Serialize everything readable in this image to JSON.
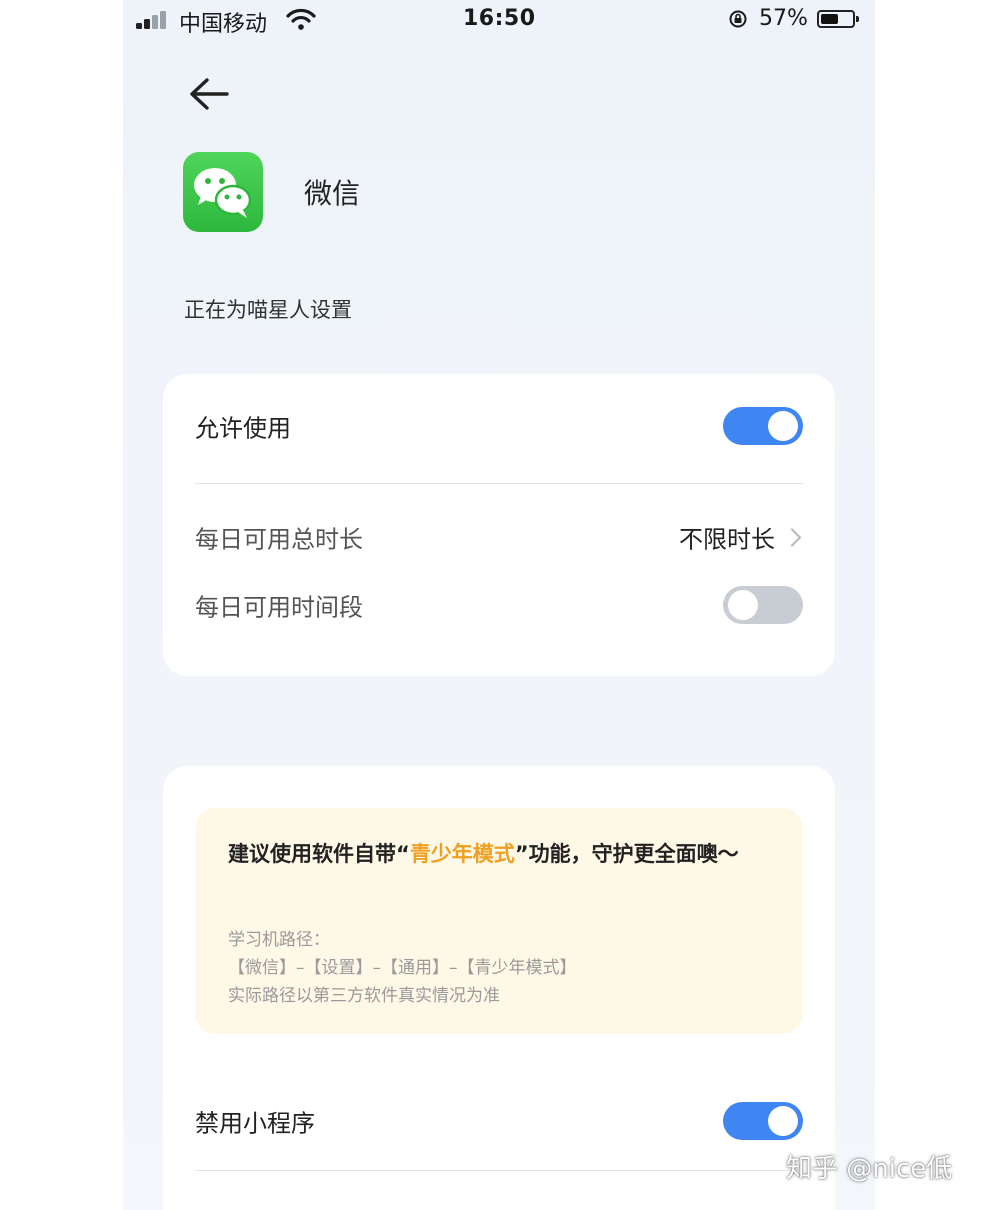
{
  "status_bar": {
    "carrier": "中国移动",
    "time": "16:50",
    "battery_percent": "57%",
    "battery_level": 0.57,
    "icons": [
      "signal-icon",
      "wifi-icon",
      "orientation-lock-icon",
      "battery-icon"
    ]
  },
  "header": {
    "back_icon": "arrow-left-icon",
    "app_icon": "wechat-icon",
    "app_name": "微信"
  },
  "setting_for": "正在为喵星人设置",
  "settings_card": {
    "allow_use": {
      "label": "允许使用",
      "enabled": true
    },
    "daily_total": {
      "label": "每日可用总时长",
      "value": "不限时长"
    },
    "daily_period": {
      "label": "每日可用时间段",
      "enabled": false
    }
  },
  "notice": {
    "title_pre": "建议使用软件自带“",
    "title_highlight": "青少年模式",
    "title_post": "”功能，守护更全面噢～",
    "path_title": "学习机路径：",
    "path": "【微信】–【设置】–【通用】–【青少年模式】",
    "disclaimer": "实际路径以第三方软件真实情况为准"
  },
  "mini_program": {
    "label": "禁用小程序",
    "enabled": true
  },
  "watermark": "知乎 @nice低",
  "colors": {
    "toggle_on": "#3f86f2",
    "toggle_off": "#c8ccd3",
    "highlight": "#f0a020",
    "wechat_green": "#2db83d",
    "notice_bg": "#fef8e7"
  }
}
